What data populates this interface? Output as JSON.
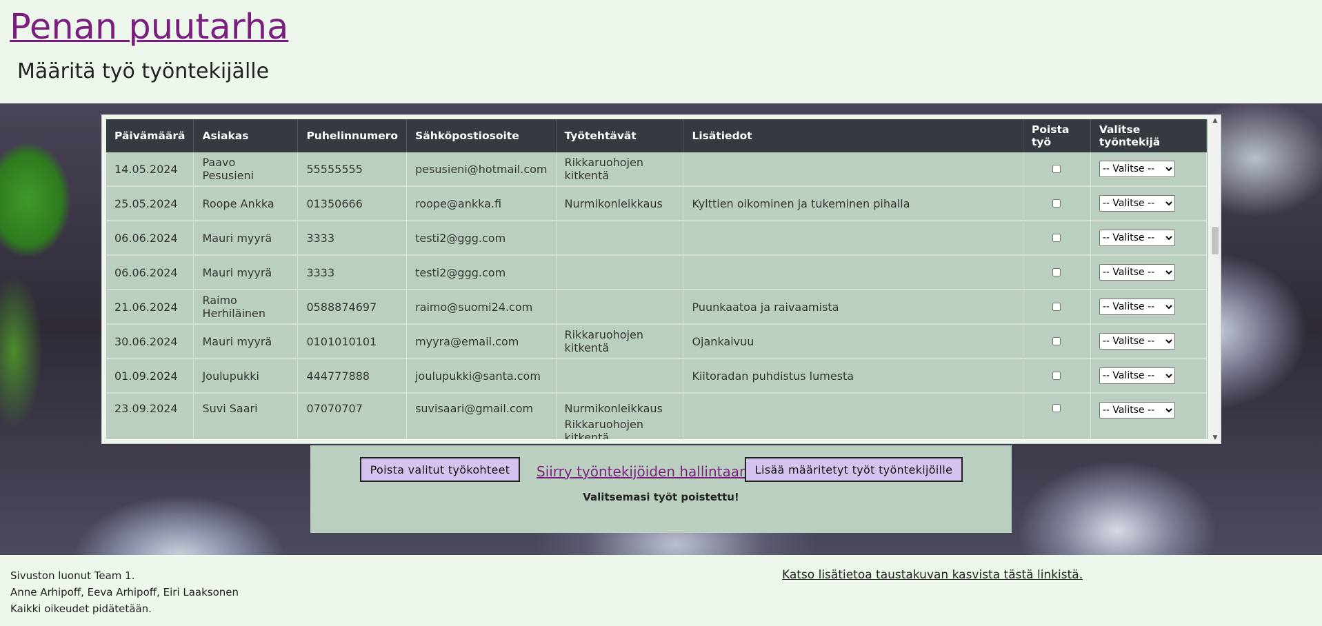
{
  "site": {
    "title": "Penan puutarha",
    "page_title": "Määritä työ työntekijälle"
  },
  "table": {
    "headers": [
      "Päivämäärä",
      "Asiakas",
      "Puhelinnumero",
      "Sähköpostiosoite",
      "Työtehtävät",
      "Lisätiedot",
      "Poista työ",
      "Valitse työntekijä"
    ],
    "rows": [
      {
        "date": "14.05.2024",
        "customer": "Paavo Pesusieni",
        "phone": "55555555",
        "email": "pesusieni@hotmail.com",
        "tasks": "Rikkaruohojen kitkentä",
        "tasks2": "",
        "info": "",
        "delete_checked": false,
        "worker": "-- Valitse --"
      },
      {
        "date": "25.05.2024",
        "customer": "Roope Ankka",
        "phone": "01350666",
        "email": "roope@ankka.fi",
        "tasks": "Nurmikonleikkaus",
        "tasks2": "",
        "info": "Kylttien oikominen ja tukeminen pihalla",
        "delete_checked": false,
        "worker": "-- Valitse --"
      },
      {
        "date": "06.06.2024",
        "customer": "Mauri myyrä",
        "phone": "3333",
        "email": "testi2@ggg.com",
        "tasks": "",
        "tasks2": "",
        "info": "",
        "delete_checked": false,
        "worker": "-- Valitse --"
      },
      {
        "date": "06.06.2024",
        "customer": "Mauri myyrä",
        "phone": "3333",
        "email": "testi2@ggg.com",
        "tasks": "",
        "tasks2": "",
        "info": "",
        "delete_checked": false,
        "worker": "-- Valitse --"
      },
      {
        "date": "21.06.2024",
        "customer": "Raimo Herhiläinen",
        "phone": "0588874697",
        "email": "raimo@suomi24.com",
        "tasks": "",
        "tasks2": "",
        "info": "Puunkaatoa ja raivaamista",
        "delete_checked": false,
        "worker": "-- Valitse --"
      },
      {
        "date": "30.06.2024",
        "customer": "Mauri myyrä",
        "phone": "0101010101",
        "email": "myyra@email.com",
        "tasks": "Rikkaruohojen kitkentä",
        "tasks2": "",
        "info": "Ojankaivuu",
        "delete_checked": false,
        "worker": "-- Valitse --"
      },
      {
        "date": "01.09.2024",
        "customer": "Joulupukki",
        "phone": "444777888",
        "email": "joulupukki@santa.com",
        "tasks": "",
        "tasks2": "",
        "info": "Kiitoradan puhdistus lumesta",
        "delete_checked": false,
        "worker": "-- Valitse --"
      },
      {
        "date": "23.09.2024",
        "customer": "Suvi Saari",
        "phone": "07070707",
        "email": "suvisaari@gmail.com",
        "tasks": "Nurmikonleikkaus",
        "tasks2": "Rikkaruohojen kitkentä",
        "info": "",
        "delete_checked": false,
        "worker": "-- Valitse --"
      }
    ]
  },
  "actions": {
    "delete_button": "Poista valitut työkohteet",
    "manage_link": "Siirry työntekijöiden hallintaan",
    "assign_button": "Lisää määritetyt työt työntekijöille",
    "status": "Valitsemasi työt poistettu!"
  },
  "footer": {
    "line1": "Sivuston luonut Team 1.",
    "line2": "Anne Arhipoff, Eeva Arhipoff, Eiri Laaksonen",
    "line3": "Kaikki oikeudet pidätetään.",
    "bg_link": "Katso lisätietoa taustakuvan kasvista tästä linkistä."
  },
  "colors": {
    "page_bg": "#eef7ec",
    "title_link": "#7a1f7f",
    "table_header_bg": "#343a40",
    "table_body_bg": "#bacfbf",
    "button_bg": "#d4c3ef"
  }
}
